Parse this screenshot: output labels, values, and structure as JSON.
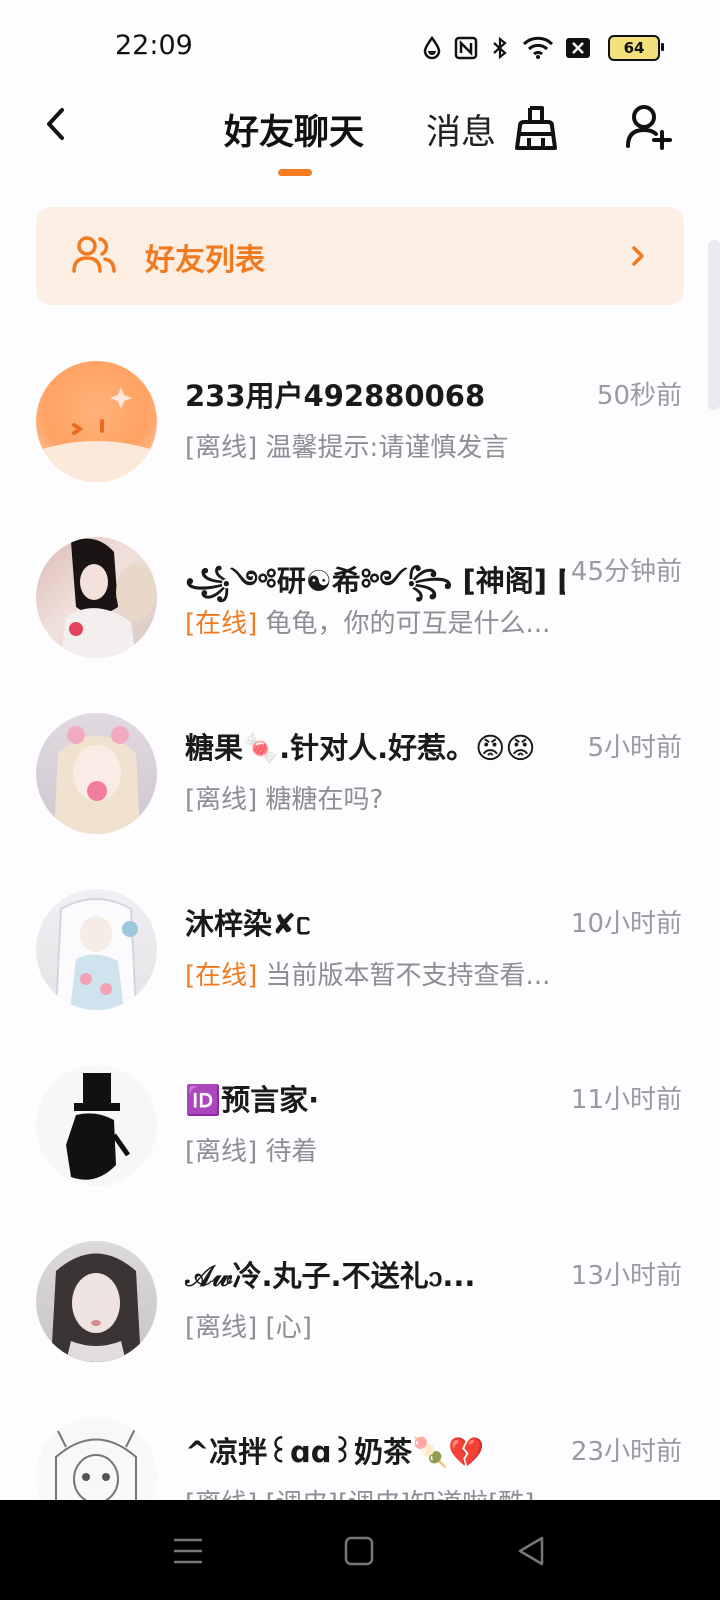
{
  "status_bar": {
    "time": "22:09",
    "battery": "64",
    "icons": [
      "data-drop-icon",
      "nfc-icon",
      "bluetooth-icon",
      "wifi-icon",
      "no-sim-icon",
      "battery-icon"
    ]
  },
  "header": {
    "tabs": [
      {
        "label": "好友聊天",
        "active": true
      },
      {
        "label": "消息",
        "active": false
      }
    ],
    "accent_color": "#f57c22"
  },
  "friend_banner": {
    "label": "好友列表"
  },
  "conversations": [
    {
      "name": "233用户492880068",
      "time": "50秒前",
      "status": "[离线]",
      "online": false,
      "preview": " 温馨提示:请谨慎发言"
    },
    {
      "name": "꧁༺研☯希༻꧂ [神阁] [可...",
      "time": "45分钟前",
      "status": "[在线]",
      "online": true,
      "preview": " 龟龟，你的可互是什么..."
    },
    {
      "name": "糖果🍬.针对人.好惹。😡😡",
      "time": "5小时前",
      "status": "[离线]",
      "online": false,
      "preview": " 糖糖在吗?"
    },
    {
      "name": "沐梓染✘ᥴ",
      "time": "10小时前",
      "status": "[在线]",
      "online": true,
      "preview": " 当前版本暂不支持查看..."
    },
    {
      "name": "🆔预言家·",
      "time": "11小时前",
      "status": "[离线]",
      "online": false,
      "preview": " 待着"
    },
    {
      "name": "𝒜𝓌冷.丸子.不送礼᧑...",
      "time": "13小时前",
      "status": "[离线]",
      "online": false,
      "preview": " [心]"
    },
    {
      "name": "^凉拌꒰ɑɑ꒱奶茶🍡💔",
      "time": "23小时前",
      "status": "[离线]",
      "online": false,
      "preview": " [调皮][调皮]知道啦[酷]"
    }
  ]
}
